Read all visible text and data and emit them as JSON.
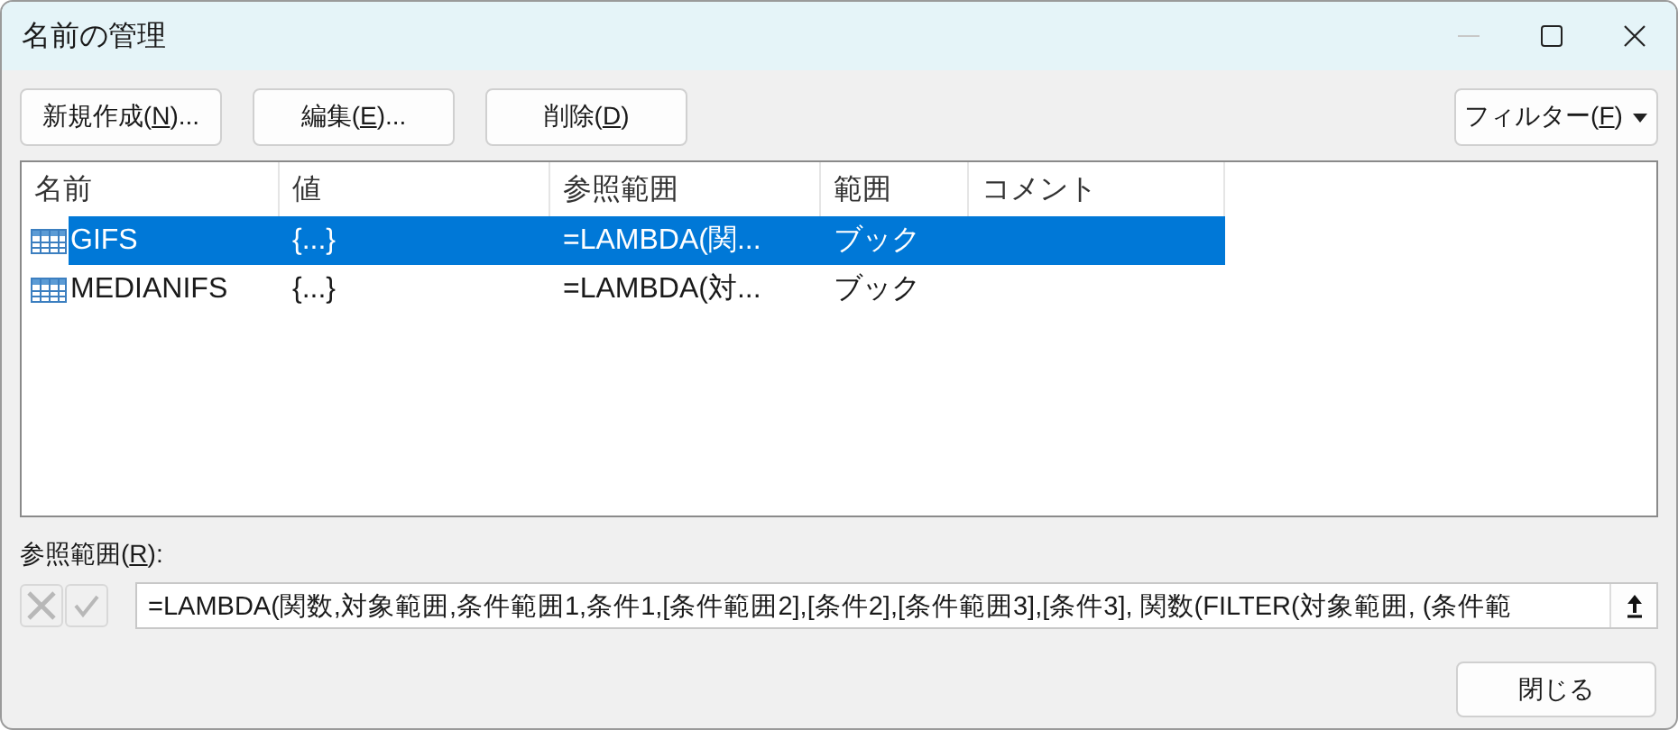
{
  "window": {
    "title": "名前の管理",
    "minimize_disabled": true
  },
  "buttons": [
    {
      "before": "新規作成(",
      "key": "N",
      "after": ")..."
    },
    {
      "before": "編集(",
      "key": "E",
      "after": ")..."
    },
    {
      "before": "削除(",
      "key": "D",
      "after": ")"
    }
  ],
  "filter_button": {
    "before": "フィルター(",
    "key": "F",
    "after": ")"
  },
  "table": {
    "columns": [
      "名前",
      "値",
      "参照範囲",
      "範囲",
      "コメント"
    ],
    "rows": [
      {
        "selected": true,
        "cells": [
          "GIFS",
          "{...}",
          "=LAMBDA(関...",
          "ブック",
          ""
        ]
      },
      {
        "selected": false,
        "cells": [
          "MEDIANIFS",
          "{...}",
          "=LAMBDA(対...",
          "ブック",
          ""
        ]
      }
    ]
  },
  "reference": {
    "label_before": "参照範囲(",
    "key": "R",
    "label_after": "):",
    "value": "=LAMBDA(関数,対象範囲,条件範囲1,条件1,[条件範囲2],[条件2],[条件範囲3],[条件3], 関数(FILTER(対象範囲, (条件範"
  },
  "close_button": "閉じる"
}
